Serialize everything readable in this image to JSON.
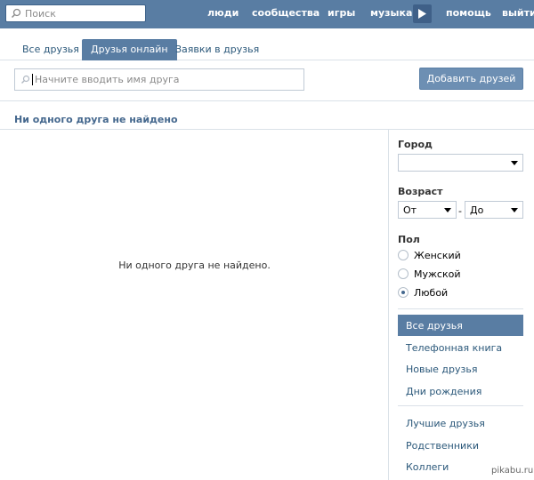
{
  "header": {
    "search_placeholder": "Поиск",
    "nav": {
      "people": "люди",
      "communities": "сообщества",
      "games": "игры",
      "music": "музыка",
      "help": "помощь",
      "exit": "выйти"
    }
  },
  "tabs": {
    "all": "Все друзья",
    "online": "Друзья онлайн",
    "requests": "Заявки в друзья"
  },
  "friend_search": {
    "placeholder": "Начните вводить имя друга",
    "add_button": "Добавить друзей"
  },
  "main": {
    "heading": "Ни одного друга не найдено",
    "empty_message": "Ни одного друга не найдено."
  },
  "filters": {
    "city_label": "Город",
    "city_value": "",
    "age_label": "Возраст",
    "age_from": "От",
    "age_dash": "-",
    "age_to": "До",
    "gender_label": "Пол",
    "gender_options": [
      "Женский",
      "Мужской",
      "Любой"
    ],
    "gender_selected": "Любой"
  },
  "side_menu": {
    "group1": [
      "Все друзья",
      "Телефонная книга",
      "Новые друзья",
      "Дни рождения"
    ],
    "group2": [
      "Лучшие друзья",
      "Родственники",
      "Коллеги"
    ]
  },
  "watermark": "pikabu.ru",
  "colors": {
    "header_bg": "#597da3",
    "link": "#2b587a",
    "accent": "#45688e"
  }
}
